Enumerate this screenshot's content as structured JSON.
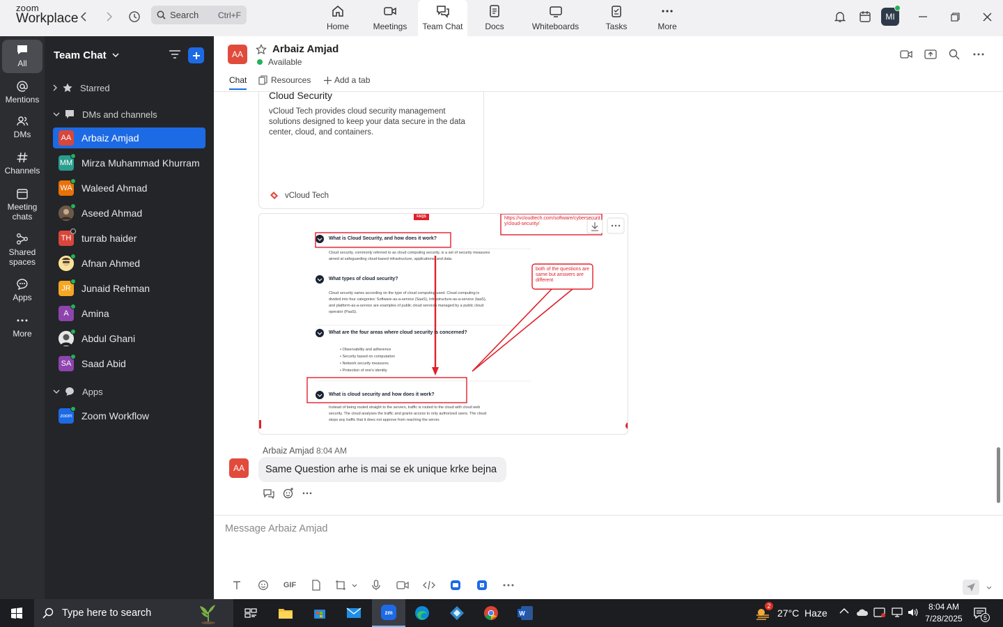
{
  "app": {
    "logo_top": "zoom",
    "logo_bottom": "Workplace"
  },
  "search": {
    "label": "Search",
    "shortcut": "Ctrl+F"
  },
  "nav_tabs": [
    {
      "label": "Home",
      "icon": "home-icon"
    },
    {
      "label": "Meetings",
      "icon": "video-camera-icon"
    },
    {
      "label": "Team Chat",
      "icon": "chat-bubbles-icon",
      "active": true
    },
    {
      "label": "Docs",
      "icon": "document-icon"
    },
    {
      "label": "Whiteboards",
      "icon": "whiteboard-icon"
    },
    {
      "label": "Tasks",
      "icon": "clipboard-icon"
    },
    {
      "label": "More",
      "icon": "more-dots-icon"
    }
  ],
  "profile": {
    "initials": "MI"
  },
  "rail": [
    {
      "label": "All",
      "active": true
    },
    {
      "label": "Mentions"
    },
    {
      "label": "DMs"
    },
    {
      "label": "Channels"
    },
    {
      "label": "Meeting chats"
    },
    {
      "label": "Shared spaces"
    },
    {
      "label": "Apps"
    },
    {
      "label": "More"
    }
  ],
  "sidebar": {
    "title": "Team Chat",
    "sections": {
      "starred": "Starred",
      "dms": "DMs and channels",
      "apps": "Apps"
    },
    "contacts": [
      {
        "initials": "AA",
        "name": "Arbaiz Amjad",
        "color": "#d9463a",
        "status": "online",
        "active": true
      },
      {
        "initials": "MM",
        "name": "Mirza Muhammad Khurram",
        "color": "#2a9d8f",
        "status": "online"
      },
      {
        "initials": "WA",
        "name": "Waleed Ahmad",
        "color": "#e8710a",
        "status": "online"
      },
      {
        "initials": "",
        "name": "Aseed Ahmad",
        "color": "#7a6a5a",
        "status": "online",
        "photo": true
      },
      {
        "initials": "TH",
        "name": "turrab haider",
        "color": "#d9463a",
        "status": "offline"
      },
      {
        "initials": "",
        "name": "Afnan Ahmed",
        "color": "#f2c94c",
        "status": "online",
        "photo": true
      },
      {
        "initials": "JR",
        "name": "Junaid Rehman",
        "color": "#f5a623",
        "status": "online"
      },
      {
        "initials": "A",
        "name": "Amina",
        "color": "#8e44ad",
        "status": "online"
      },
      {
        "initials": "",
        "name": "Abdul Ghani",
        "color": "#cfcfcf",
        "status": "online",
        "photo": true
      },
      {
        "initials": "SA",
        "name": "Saad Abid",
        "color": "#8e44ad",
        "status": "online"
      }
    ],
    "apps": [
      {
        "initials": "zoom",
        "name": "Zoom Workflow",
        "color": "#1d6ae5"
      }
    ]
  },
  "chat": {
    "name": "Arbaiz Amjad",
    "initials": "AA",
    "status": "Available",
    "tabs": [
      "Chat",
      "Resources",
      "Add a tab"
    ],
    "link_card": {
      "title": "Cloud Security",
      "desc": "vCloud Tech provides cloud security management solutions designed to keep your data secure in the data center, cloud, and containers.",
      "site": "vCloud Tech"
    },
    "screenshot": {
      "badge": "FAQS",
      "url_note": "https://vcloudtech.com/software/cybersecurity/cloud-security/",
      "annotation": "both of the questions are same but answers are different",
      "q1": "What is Cloud Security, and how does it work?",
      "a1a": "Cloud security, commonly referred to as cloud computing security, is a set of security measures",
      "a1b": "aimed at safeguarding cloud-based infrastructure, applications, and data.",
      "q2": "What types of cloud security?",
      "a2a": "Cloud security varies according on the type of cloud computing used. Cloud computing is",
      "a2b": "divided into four categories: Software-as-a-service (SaaS), Infrastructure-as-a-service (IaaS),",
      "a2c": "and platform-as-a-service are examples of public cloud services managed by a public cloud",
      "a2d": "operator (PaaS).",
      "q3": "What are the four areas where cloud security is concerned?",
      "bullets": [
        "Observability and adherence",
        "Security based on computation",
        "Network security measures",
        "Protection of one's identity"
      ],
      "q4": "What is cloud security and how does it work?",
      "a4a": "Instead of being routed straight to the servers, traffic is routed to the cloud with cloud web",
      "a4b": "security. The cloud analyses the traffic and grants access to only authorized users. The cloud",
      "a4c": "stops any traffic that it does not approve from reaching the server."
    },
    "message": {
      "sender": "Arbaiz Amjad",
      "time": "8:04 AM",
      "text": "Same Question arhe is mai se ek unique krke bejna"
    },
    "compose_placeholder": "Message Arbaiz Amjad",
    "gif_label": "GIF"
  },
  "taskbar": {
    "search_placeholder": "Type here to search",
    "weather": "27°C  Haze",
    "weather_badge": "2",
    "time": "8:04 AM",
    "date": "7/28/2025",
    "notif_count": "5"
  }
}
